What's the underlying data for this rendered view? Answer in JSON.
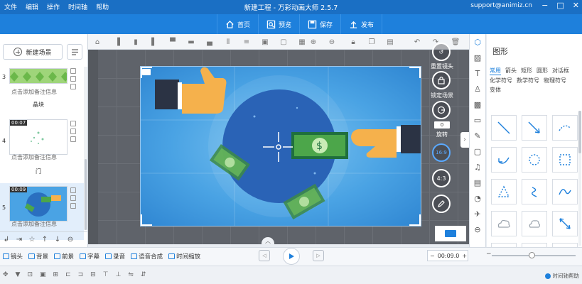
{
  "window": {
    "menu": [
      "文件",
      "编辑",
      "操作",
      "时间轴",
      "帮助"
    ],
    "title": "新建工程 - 万彩动画大师 2.5.7",
    "account": "support@animiz.cn"
  },
  "toolbar": {
    "home_label": "首页",
    "preview_label": "预览",
    "save_label": "保存",
    "publish_label": "发布"
  },
  "left_panel": {
    "new_scene_label": "新建场景",
    "scenes": [
      {
        "number": "3",
        "time": "",
        "note": "点击添加备注信息",
        "name": "晶块"
      },
      {
        "number": "4",
        "time": "00:07",
        "note": "点击添加备注信息",
        "name": "门"
      },
      {
        "number": "5",
        "time": "00:09",
        "note": "点击添加备注信息",
        "name": ""
      }
    ]
  },
  "camera_controls": {
    "reset_label": "重置镜头",
    "lock_label": "锁定场景",
    "rotate_value": "0",
    "rotate_label": "旋转",
    "ratio_16_9": "16:9",
    "ratio_4_3": "4:3"
  },
  "right_panel": {
    "title": "图形",
    "tabs": [
      "常用",
      "箭头",
      "矩形",
      "圆形",
      "对话框",
      "化学符号",
      "数学符号",
      "物理符号",
      "变体"
    ],
    "active_tab": "常用"
  },
  "timeline": {
    "tabs": [
      "镜头",
      "背景",
      "前景",
      "字幕",
      "录音",
      "语音合成",
      "时间缩放"
    ],
    "time_value": "00:09.0"
  },
  "bottom": {
    "help_label": "时间轴帮助"
  },
  "colors": {
    "title_bar": "#1a6fc4",
    "toolbar": "#1e80dc",
    "accent": "#1e80dc",
    "canvas_bg": "#5f636a"
  }
}
